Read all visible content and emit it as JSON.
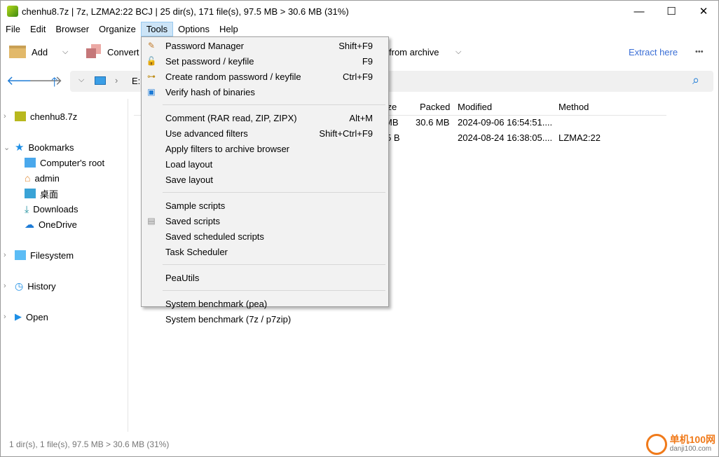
{
  "window": {
    "title": "chenhu8.7z | 7z, LZMA2:22 BCJ | 25 dir(s), 171 file(s), 97.5 MB > 30.6 MB (31%)",
    "minimize": "—",
    "maximize": "☐",
    "close": "✕"
  },
  "menubar": [
    "File",
    "Edit",
    "Browser",
    "Organize",
    "Tools",
    "Options",
    "Help"
  ],
  "toolbar": {
    "add": "Add",
    "convert": "Convert",
    "extract_from": "from archive",
    "extract_here": "Extract here",
    "more": "•••"
  },
  "address": {
    "path": "E:"
  },
  "sidebar": {
    "archive": "chenhu8.7z",
    "bookmarks": "Bookmarks",
    "items": [
      "Computer's root",
      "admin",
      "桌面",
      "Downloads",
      "OneDrive"
    ],
    "filesystem": "Filesystem",
    "history": "History",
    "open": "Open"
  },
  "table": {
    "headers": [
      "Size",
      "Packed",
      "Modified",
      "Method"
    ],
    "rows": [
      {
        "size": "MB",
        "packed": "30.6 MB",
        "modified": "2024-09-06 16:54:51....",
        "method": ""
      },
      {
        "size": "5 B",
        "packed": "",
        "modified": "2024-08-24 16:38:05....",
        "method": "LZMA2:22"
      }
    ]
  },
  "status": "1 dir(s), 1 file(s), 97.5 MB > 30.6 MB (31%)",
  "tools_menu": {
    "groups": [
      [
        {
          "label": "Password Manager",
          "shortcut": "Shift+F9",
          "icon": "pencil-icon"
        },
        {
          "label": "Set password / keyfile",
          "shortcut": "F9",
          "icon": "padlock-icon"
        },
        {
          "label": "Create random password / keyfile",
          "shortcut": "Ctrl+F9",
          "icon": "key-icon"
        },
        {
          "label": "Verify hash of binaries",
          "shortcut": "",
          "icon": "hash-window-icon"
        }
      ],
      [
        {
          "label": "Comment (RAR read, ZIP, ZIPX)",
          "shortcut": "Alt+M"
        },
        {
          "label": "Use advanced filters",
          "shortcut": "Shift+Ctrl+F9"
        },
        {
          "label": "Apply filters to archive browser",
          "shortcut": ""
        },
        {
          "label": "Load layout",
          "shortcut": ""
        },
        {
          "label": "Save layout",
          "shortcut": ""
        }
      ],
      [
        {
          "label": "Sample scripts",
          "shortcut": ""
        },
        {
          "label": "Saved scripts",
          "shortcut": "",
          "icon": "script-icon"
        },
        {
          "label": "Saved scheduled scripts",
          "shortcut": ""
        },
        {
          "label": "Task Scheduler",
          "shortcut": ""
        }
      ],
      [
        {
          "label": "PeaUtils",
          "shortcut": ""
        }
      ],
      [
        {
          "label": "System benchmark (pea)",
          "shortcut": ""
        },
        {
          "label": "System benchmark (7z / p7zip)",
          "shortcut": ""
        }
      ]
    ]
  },
  "watermark": {
    "text": "单机100网",
    "sub": "danji100.com"
  },
  "colors": {
    "accent": "#1e7bd6",
    "menu_highlight": "#cce4f7",
    "link": "#3b6fd6"
  }
}
